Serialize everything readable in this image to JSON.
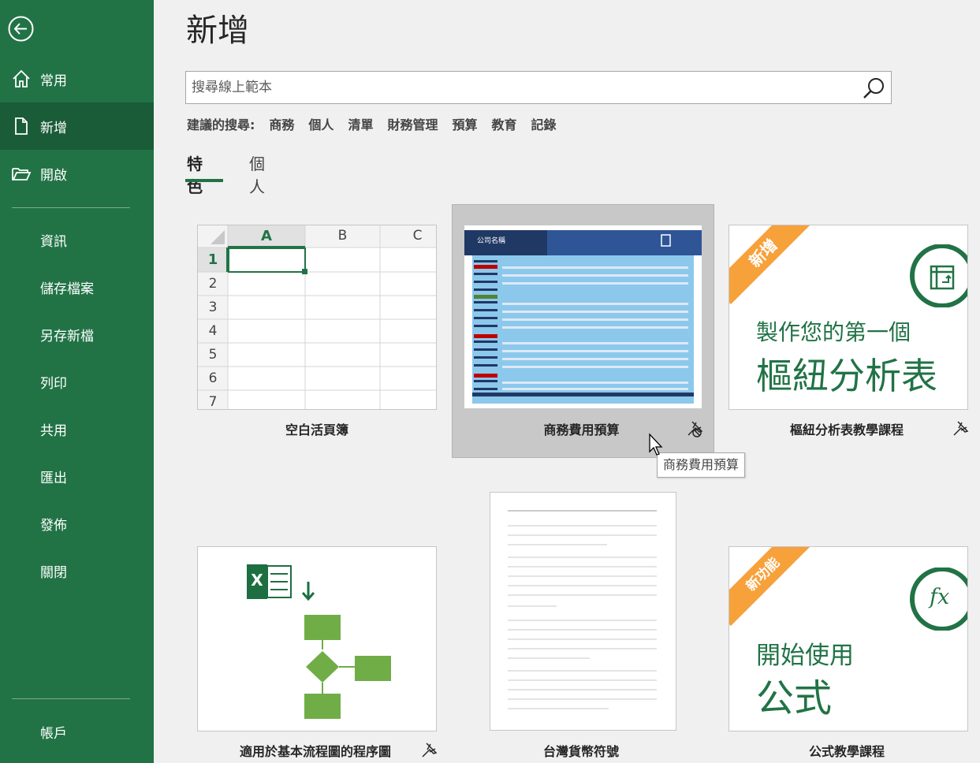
{
  "sidebar": {
    "main_items": [
      {
        "label": "常用",
        "icon": "home-icon"
      },
      {
        "label": "新增",
        "icon": "new-document-icon",
        "active": true
      },
      {
        "label": "開啟",
        "icon": "folder-open-icon"
      }
    ],
    "plain_items": [
      "資訊",
      "儲存檔案",
      "另存新檔",
      "列印",
      "共用",
      "匯出",
      "發佈",
      "關閉"
    ],
    "account": "帳戶"
  },
  "page": {
    "title": "新增",
    "search_placeholder": "搜尋線上範本",
    "suggested_label": "建議的搜尋:",
    "suggested": [
      "商務",
      "個人",
      "清單",
      "財務管理",
      "預算",
      "教育",
      "記錄"
    ],
    "tabs": [
      {
        "label": "特色",
        "active": true
      },
      {
        "label": "個人"
      }
    ]
  },
  "templates": [
    {
      "label": "空白活頁簿",
      "kind": "blank-workbook"
    },
    {
      "label": "商務費用預算",
      "kind": "budget",
      "hovered": true
    },
    {
      "label": "樞紐分析表教學課程",
      "kind": "pivot"
    },
    {
      "label": "適用於基本流程圖的程序圖",
      "kind": "flowchart"
    },
    {
      "label": "台灣貨幣符號",
      "kind": "document"
    },
    {
      "label": "公式教學課程",
      "kind": "formula"
    }
  ],
  "blank_workbook": {
    "columns": [
      "A",
      "B",
      "C"
    ],
    "rows": [
      "1",
      "2",
      "3",
      "4",
      "5",
      "6",
      "7"
    ]
  },
  "budget_thumb": {
    "company": "公司名稱"
  },
  "pivot_thumb": {
    "ribbon": "新增",
    "line1": "製作您的第一個",
    "line2": "樞紐分析表"
  },
  "formula_thumb": {
    "ribbon": "新功能",
    "line1": "開始使用",
    "line2": "公式",
    "symbol": "fx"
  },
  "flowchart_thumb": {
    "excel_letter": "X"
  },
  "tooltip": "商務費用預算",
  "colors": {
    "excel_green": "#217346",
    "active_nav": "#1a5c38",
    "ribbon_orange": "#f7a13b",
    "budget_blue": "#203864",
    "flow_green": "#70ad47"
  }
}
